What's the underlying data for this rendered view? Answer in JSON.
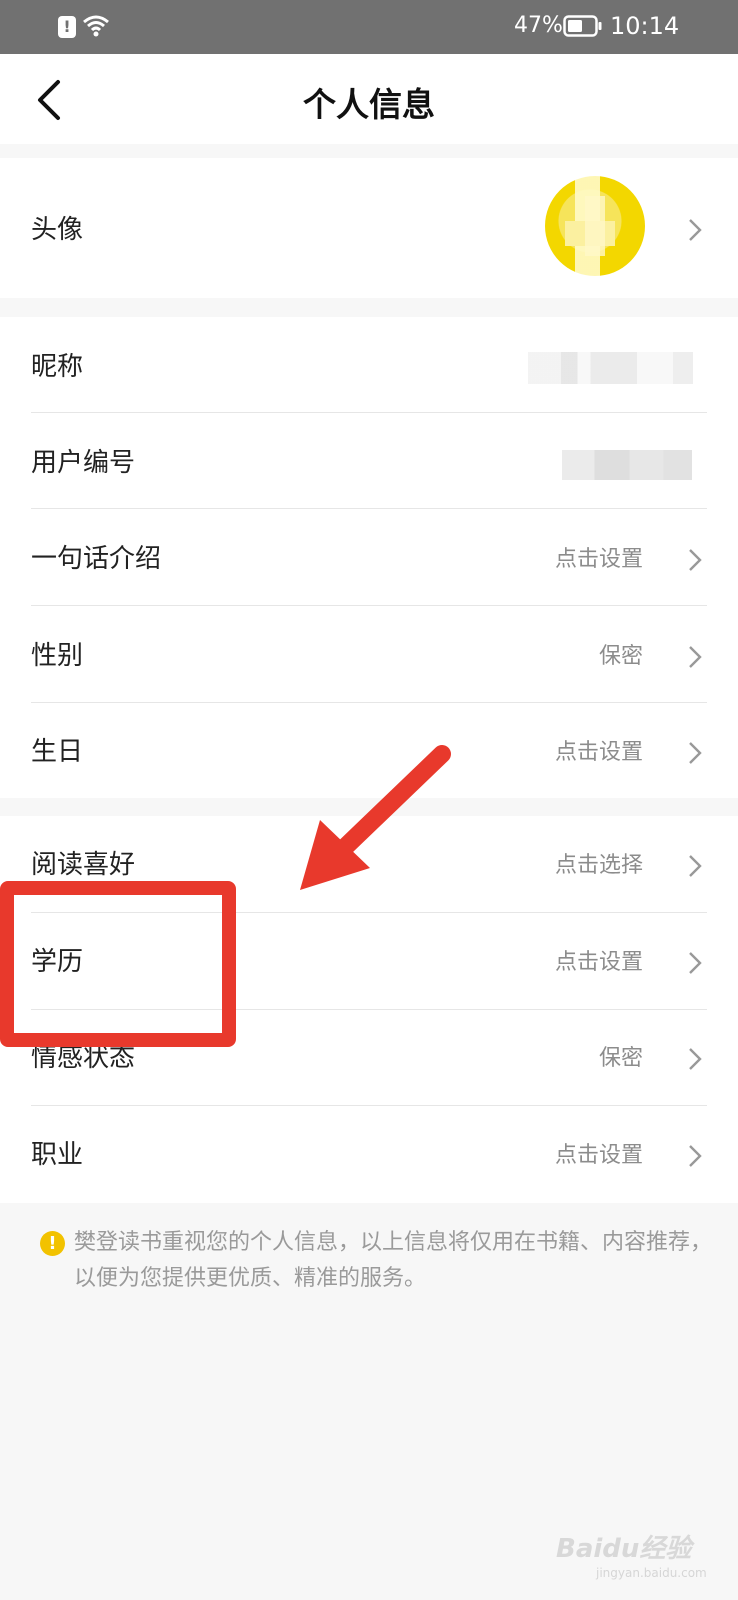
{
  "status_bar": {
    "alert_glyph": "!",
    "battery_percent": "47%",
    "time": "10:14"
  },
  "header": {
    "title": "个人信息"
  },
  "avatar_row": {
    "label": "头像"
  },
  "profile_rows": [
    {
      "label": "昵称"
    },
    {
      "label": "用户编号"
    },
    {
      "label": "一句话介绍",
      "value": "点击设置"
    },
    {
      "label": "性别",
      "value": "保密"
    },
    {
      "label": "生日",
      "value": "点击设置"
    }
  ],
  "detail_rows": [
    {
      "label": "阅读喜好",
      "value": "点击选择"
    },
    {
      "label": "学历",
      "value": "点击设置"
    },
    {
      "label": "情感状态",
      "value": "保密"
    },
    {
      "label": "职业",
      "value": "点击设置"
    }
  ],
  "note": {
    "icon_glyph": "!",
    "text": "樊登读书重视您的个人信息，以上信息将仅用在书籍、内容推荐，以便为您提供更优质、精准的服务。"
  },
  "watermark": {
    "brand": "Baidu经验",
    "url": "jingyan.baidu.com"
  },
  "colors": {
    "status_bar": "#717171",
    "annotation": "#e8392c",
    "value_text": "#8c8c8c",
    "note_icon": "#f2c200"
  }
}
